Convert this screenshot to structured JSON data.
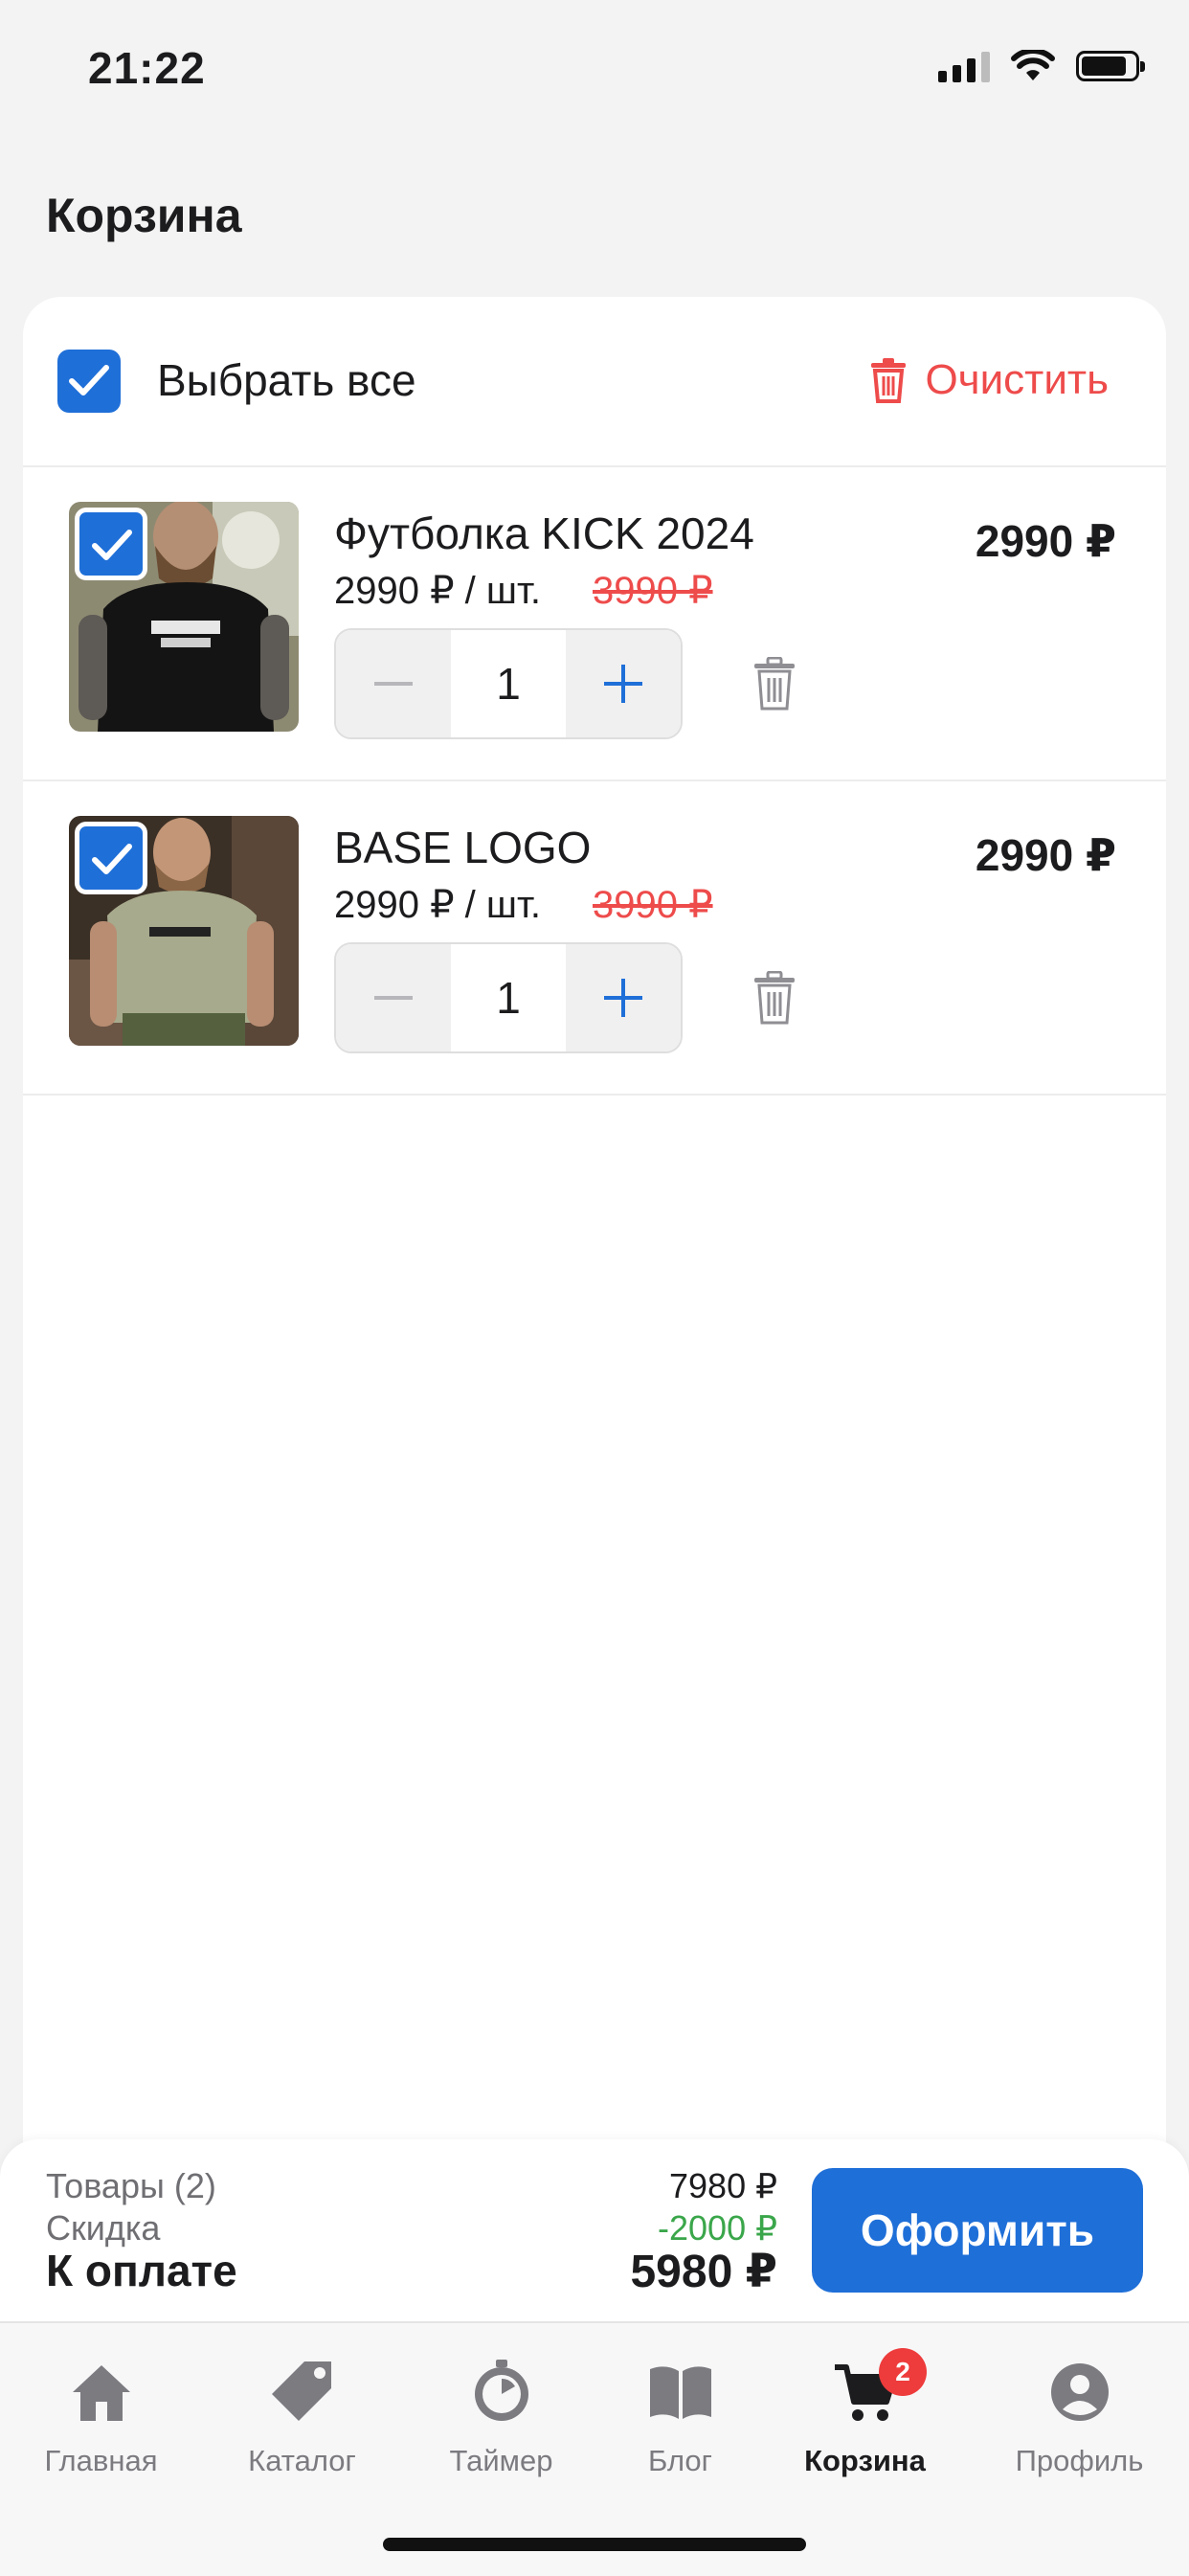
{
  "status_bar": {
    "time": "21:22",
    "battery_percent": 85
  },
  "title": "Корзина",
  "select_all": {
    "label": "Выбрать все",
    "checked": true
  },
  "clear_label": "Очистить",
  "items": [
    {
      "name": "Футболка KICK 2024",
      "unit_price": "2990 ₽ / шт.",
      "old_price": "3990 ₽",
      "quantity": "1",
      "total": "2990 ₽",
      "checked": true,
      "image_shirt_color": "#141414"
    },
    {
      "name": "BASE LOGO",
      "unit_price": "2990 ₽ / шт.",
      "old_price": "3990 ₽",
      "quantity": "1",
      "total": "2990 ₽",
      "checked": true,
      "image_shirt_color": "#a7aa8c"
    }
  ],
  "summary": {
    "items_label": "Товары (2)",
    "items_value": "7980 ₽",
    "discount_label": "Скидка",
    "discount_value": "-2000 ₽",
    "total_label": "К оплате",
    "total_value": "5980 ₽",
    "checkout_label": "Оформить"
  },
  "tabs": [
    {
      "label": "Главная",
      "icon": "home-icon"
    },
    {
      "label": "Каталог",
      "icon": "tag-icon"
    },
    {
      "label": "Таймер",
      "icon": "timer-icon"
    },
    {
      "label": "Блог",
      "icon": "book-icon"
    },
    {
      "label": "Корзина",
      "icon": "cart-icon",
      "active": true,
      "badge": "2"
    },
    {
      "label": "Профиль",
      "icon": "profile-icon"
    }
  ],
  "colors": {
    "accent": "#1f6fd8",
    "danger": "#ee4b4b",
    "discount": "#3aa64a"
  }
}
